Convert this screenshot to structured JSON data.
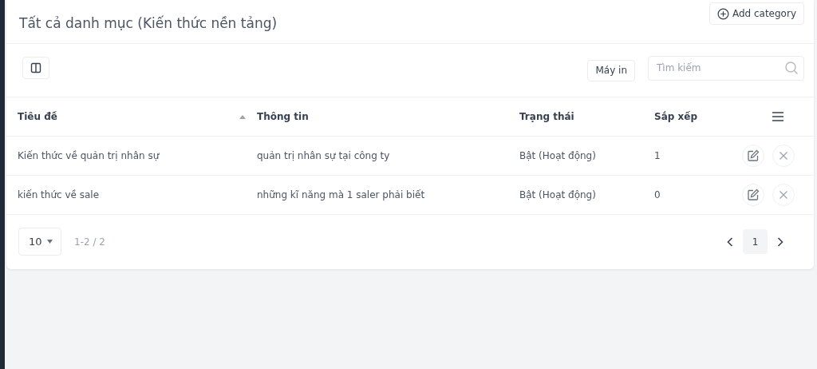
{
  "header": {
    "title": "Tất cả danh mục (Kiến thức nền tảng)",
    "add_button": "Add category"
  },
  "toolbar": {
    "print_button": "Máy in",
    "search": {
      "placeholder": "Tìm kiếm"
    }
  },
  "table": {
    "columns": [
      {
        "label": "Tiêu đề",
        "sorted": true
      },
      {
        "label": "Thông tin",
        "sorted": false
      },
      {
        "label": "Trạng thái",
        "sorted": false
      },
      {
        "label": "Sắp xếp",
        "sorted": false
      }
    ],
    "rows": [
      {
        "title": "Kiến thức về quản trị nhân sự",
        "info": "quản trị nhân sự tại công ty",
        "status": "Bật (Hoạt động)",
        "order": "1"
      },
      {
        "title": "kiến thức về sale",
        "info": "những kĩ năng mà 1 saler phải biết",
        "status": "Bật (Hoạt động)",
        "order": "0"
      }
    ]
  },
  "pagination": {
    "page_size": "10",
    "range": "1-2 / 2",
    "pages": [
      {
        "label": "1",
        "selected": true
      }
    ]
  }
}
